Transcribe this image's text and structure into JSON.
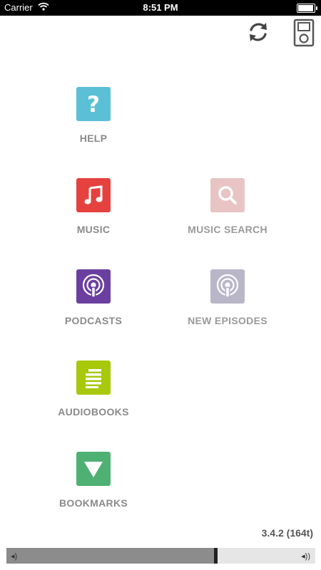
{
  "status_bar": {
    "carrier": "Carrier",
    "time": "8:51 PM",
    "battery_level": 0.95
  },
  "toolbar": {
    "refresh_icon": "refresh-icon",
    "device_icon": "ipod-icon"
  },
  "menu": {
    "help": {
      "label": "HELP",
      "color": "#5bc0d6",
      "icon": "question-mark-icon"
    },
    "music": {
      "label": "MUSIC",
      "color": "#e5423f",
      "icon": "music-note-icon"
    },
    "music_search": {
      "label": "MUSIC SEARCH",
      "color": "#e8c4c4",
      "icon": "search-icon"
    },
    "podcasts": {
      "label": "PODCASTS",
      "color": "#6b3fa0",
      "icon": "podcast-icon"
    },
    "new_episodes": {
      "label": "NEW EPISODES",
      "color": "#b9b6c8",
      "icon": "podcast-icon"
    },
    "audiobooks": {
      "label": "AUDIOBOOKS",
      "color": "#a8c80b",
      "icon": "audiobook-lines-icon"
    },
    "bookmarks": {
      "label": "BOOKMARKS",
      "color": "#4fb074",
      "icon": "triangle-down-icon"
    }
  },
  "version": "3.4.2 (164t)",
  "volume": {
    "level": 0.68
  }
}
